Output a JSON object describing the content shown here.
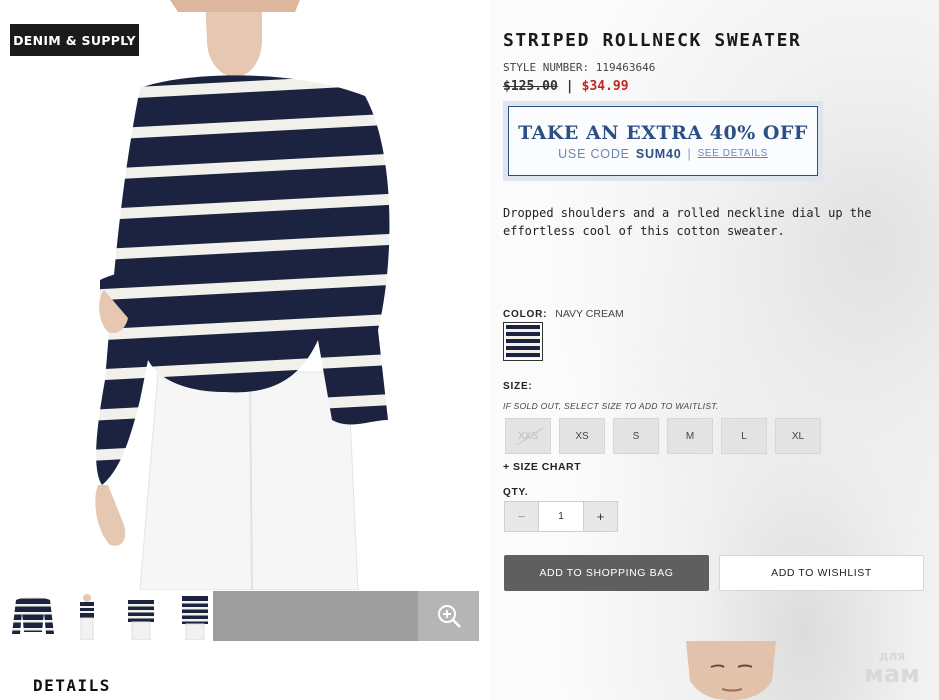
{
  "brand": {
    "badge": "DENIM & SUPPLY"
  },
  "product": {
    "title": "STRIPED ROLLNECK SWEATER",
    "style_number": "STYLE NUMBER: 119463646",
    "price_original": "$125.00",
    "price_separator": "|",
    "price_sale": "$34.99",
    "description": "Dropped shoulders and a rolled neckline dial up the effortless cool of this cotton sweater."
  },
  "promo": {
    "headline": "TAKE AN EXTRA 40% OFF",
    "code_prefix": "USE CODE",
    "code": "SUM40",
    "divider": "|",
    "link": "SEE DETAILS"
  },
  "color": {
    "label": "COLOR:",
    "value": "NAVY CREAM"
  },
  "size": {
    "label": "SIZE:",
    "note": "IF SOLD OUT, SELECT SIZE TO ADD TO WAITLIST.",
    "options": [
      {
        "label": "XXS",
        "sold_out": true
      },
      {
        "label": "XS",
        "sold_out": false
      },
      {
        "label": "S",
        "sold_out": false
      },
      {
        "label": "M",
        "sold_out": false
      },
      {
        "label": "L",
        "sold_out": false
      },
      {
        "label": "XL",
        "sold_out": false
      }
    ],
    "chart_link": "+ SIZE CHART"
  },
  "quantity": {
    "label": "QTY.",
    "minus": "−",
    "value": "1",
    "plus": "+"
  },
  "actions": {
    "add_to_bag": "ADD TO SHOPPING BAG",
    "add_to_wishlist": "ADD TO WISHLIST"
  },
  "details": {
    "title": "DETAILS"
  },
  "watermark": {
    "small": "для",
    "big": "мам"
  },
  "colors": {
    "sale_price": "#c02424",
    "promo_blue": "#2c4f85",
    "sweater_navy": "#1b2340",
    "sweater_cream": "#f2f0ea"
  }
}
